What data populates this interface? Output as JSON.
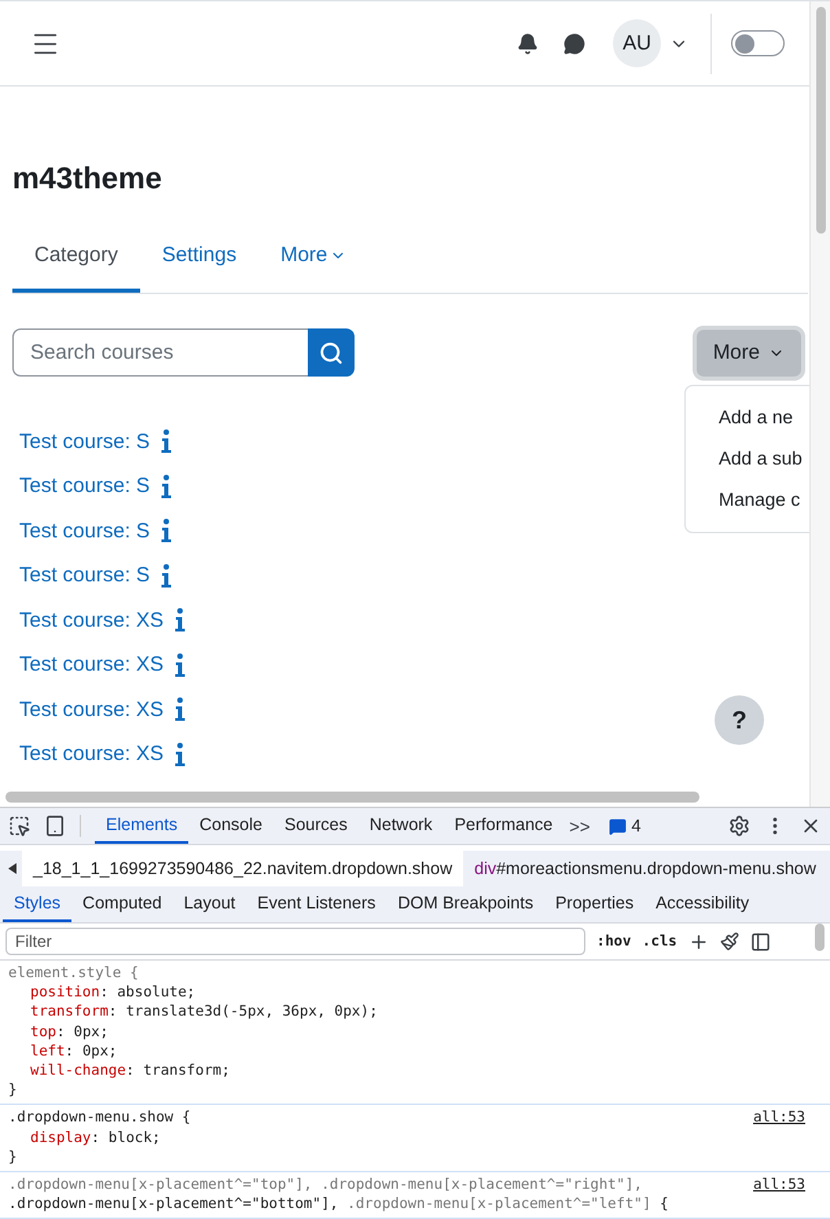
{
  "header": {
    "avatar": "AU",
    "notifications_toggle_on": false
  },
  "page": {
    "title": "m43theme",
    "tabs": [
      {
        "label": "Category",
        "selected": true,
        "kind": "plain"
      },
      {
        "label": "Settings",
        "selected": false,
        "kind": "plain"
      },
      {
        "label": "More",
        "selected": false,
        "kind": "menu"
      }
    ],
    "search": {
      "placeholder": "Search courses"
    },
    "more_button": {
      "label": "More",
      "expanded": true
    },
    "more_menu": [
      "Add a ne",
      "Add a sub",
      "Manage c"
    ],
    "courses": [
      "Test course: S",
      "Test course: S",
      "Test course: S",
      "Test course: S",
      "Test course: XS",
      "Test course: XS",
      "Test course: XS",
      "Test course: XS"
    ],
    "help": "?"
  },
  "devtools": {
    "tabs": [
      {
        "label": "Elements",
        "selected": true
      },
      {
        "label": "Console",
        "selected": false
      },
      {
        "label": "Sources",
        "selected": false
      },
      {
        "label": "Network",
        "selected": false
      },
      {
        "label": "Performance",
        "selected": false
      }
    ],
    "overflow": ">>",
    "messages": "4",
    "breadcrumbs": [
      {
        "selector": "_18_1_1_1699273590486_22.navitem.dropdown.show"
      },
      {
        "tag": "div",
        "selector": "#moreactionsmenu.dropdown-menu.show"
      }
    ],
    "panel_tabs": [
      {
        "label": "Styles",
        "selected": true
      },
      {
        "label": "Computed",
        "selected": false
      },
      {
        "label": "Layout",
        "selected": false
      },
      {
        "label": "Event Listeners",
        "selected": false
      },
      {
        "label": "DOM Breakpoints",
        "selected": false
      },
      {
        "label": "Properties",
        "selected": false
      },
      {
        "label": "Accessibility",
        "selected": false
      }
    ],
    "filter": {
      "placeholder": "Filter"
    },
    "hov": ":hov",
    "cls": ".cls",
    "rules": [
      {
        "selector": [
          {
            "text": "element.style {",
            "matched": false
          }
        ],
        "declarations": [
          {
            "property": "position",
            "colon": ":",
            "value": "absolute;"
          },
          {
            "property": "transform",
            "colon": ":",
            "value": "translate3d(-5px, 36px, 0px);"
          },
          {
            "property": "top",
            "colon": ":",
            "value": "0px;"
          },
          {
            "property": "left",
            "colon": ":",
            "value": "0px;"
          },
          {
            "property": "will-change",
            "colon": ":",
            "value": "transform;"
          }
        ],
        "close": "}"
      },
      {
        "selector": [
          {
            "text": ".dropdown-menu.show {",
            "matched": true
          }
        ],
        "source": "all:53",
        "declarations": [
          {
            "property": "display",
            "colon": ":",
            "value": "block;"
          }
        ],
        "close": "}"
      },
      {
        "selector": [
          {
            "text": ".dropdown-menu[x-placement^=\"top\"], .dropdown-menu[x-placement^=\"right\"],",
            "matched": false
          },
          {
            "text": ".dropdown-menu[x-placement^=\"bottom\"],",
            "matched": true
          },
          {
            "text": " .dropdown-menu[x-placement^=\"left\"]",
            "matched": false
          },
          {
            "text": " {",
            "matched": true
          }
        ],
        "source": "all:53"
      }
    ]
  }
}
